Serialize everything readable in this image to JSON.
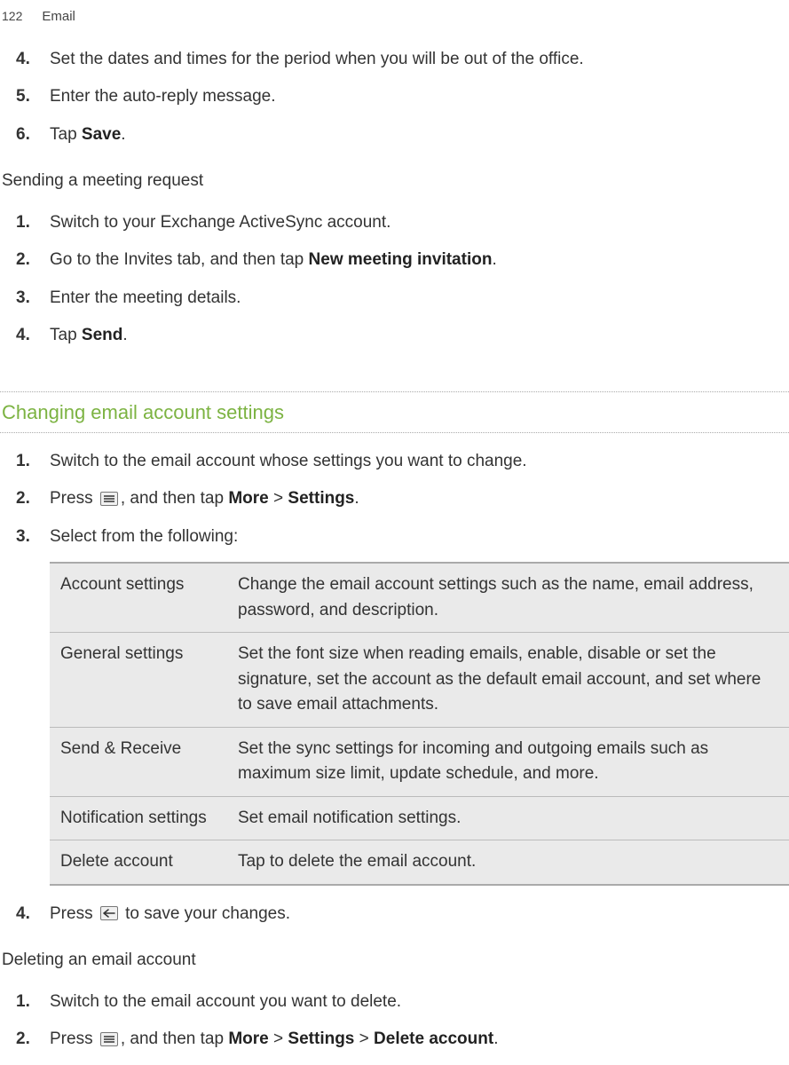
{
  "header": {
    "page_number": "122",
    "section": "Email"
  },
  "list1": {
    "items": [
      {
        "num": "4.",
        "text": "Set the dates and times for the period when you will be out of the office."
      },
      {
        "num": "5.",
        "text": "Enter the auto-reply message."
      },
      {
        "num": "6.",
        "text_before": "Tap ",
        "bold": "Save",
        "text_after": "."
      }
    ]
  },
  "subheading1": "Sending a meeting request",
  "list2": {
    "items": [
      {
        "num": "1.",
        "text": "Switch to your Exchange ActiveSync account."
      },
      {
        "num": "2.",
        "text_before": "Go to the Invites tab, and then tap ",
        "bold": "New meeting invitation",
        "text_after": "."
      },
      {
        "num": "3.",
        "text": "Enter the meeting details."
      },
      {
        "num": "4.",
        "text_before": "Tap ",
        "bold": "Send",
        "text_after": "."
      }
    ]
  },
  "green_heading": "Changing email account settings",
  "list3": {
    "items": [
      {
        "num": "1.",
        "text": "Switch to the email account whose settings you want to change."
      },
      {
        "num": "2.",
        "text_before": "Press ",
        "icon": "menu",
        "text_mid": ", and then tap ",
        "bold1": "More",
        "gt": " > ",
        "bold2": "Settings",
        "text_after": "."
      },
      {
        "num": "3.",
        "text": "Select from the following:"
      }
    ]
  },
  "table": {
    "rows": [
      {
        "label": "Account settings",
        "desc": "Change the email account settings such as the name, email address, password, and description."
      },
      {
        "label": "General settings",
        "desc": "Set the font size when reading emails, enable, disable or set the signature, set the account as the default email account, and set where to save email attachments."
      },
      {
        "label": "Send & Receive",
        "desc": "Set the sync settings for incoming and outgoing emails such as maximum size limit, update schedule, and more."
      },
      {
        "label": "Notification settings",
        "desc": "Set email notification settings."
      },
      {
        "label": "Delete account",
        "desc": "Tap to delete the email account."
      }
    ]
  },
  "list4": {
    "items": [
      {
        "num": "4.",
        "text_before": "Press ",
        "icon": "back",
        "text_after": " to save your changes."
      }
    ]
  },
  "subheading2": "Deleting an email account",
  "list5": {
    "items": [
      {
        "num": "1.",
        "text": "Switch to the email account you want to delete."
      },
      {
        "num": "2.",
        "text_before": "Press ",
        "icon": "menu",
        "text_mid": ", and then tap ",
        "bold1": "More",
        "gt1": " > ",
        "bold2": "Settings",
        "gt2": " > ",
        "bold3": "Delete account",
        "text_after": "."
      }
    ]
  }
}
